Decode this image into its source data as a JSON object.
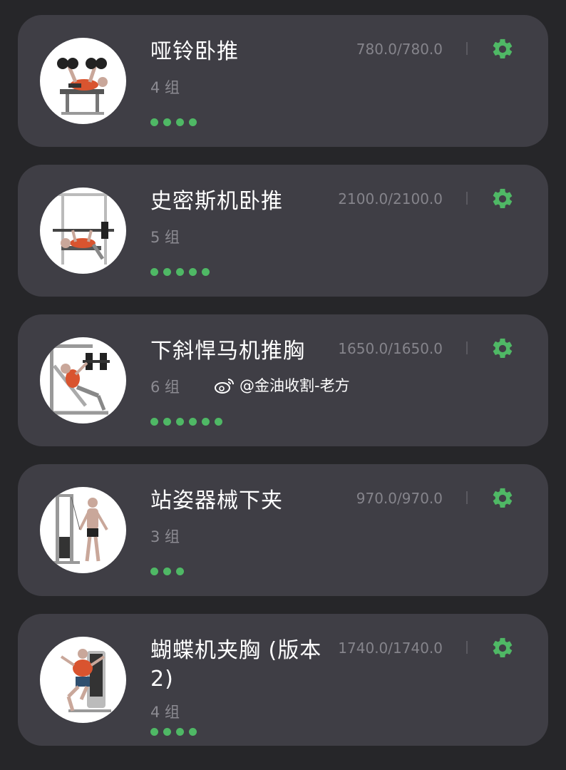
{
  "exercises": [
    {
      "name": "哑铃卧推",
      "sets": "4 组",
      "volume": "780.0/780.0",
      "set_count": 4,
      "thumbnail_icon": "dumbbell-bench-press-illustration"
    },
    {
      "name": "史密斯机卧推",
      "sets": "5 组",
      "volume": "2100.0/2100.0",
      "set_count": 5,
      "thumbnail_icon": "smith-machine-bench-press-illustration"
    },
    {
      "name": "下斜悍马机推胸",
      "sets": "6 组",
      "volume": "1650.0/1650.0",
      "set_count": 6,
      "thumbnail_icon": "decline-hammer-press-illustration"
    },
    {
      "name": "站姿器械下夹",
      "sets": "3 组",
      "volume": "970.0/970.0",
      "set_count": 3,
      "thumbnail_icon": "standing-cable-crossover-illustration"
    },
    {
      "name": "蝴蝶机夹胸 (版本 2)",
      "sets": "4 组",
      "volume": "1740.0/1740.0",
      "set_count": 4,
      "thumbnail_icon": "pec-deck-fly-illustration"
    }
  ],
  "watermark": {
    "text": "@金油收割-老方",
    "icon": "weibo-icon"
  },
  "colors": {
    "background": "#262629",
    "card": "#3f3e45",
    "accent_green": "#4fb865",
    "muted_text": "#8c8b92"
  },
  "settings_icon": "gear-icon"
}
